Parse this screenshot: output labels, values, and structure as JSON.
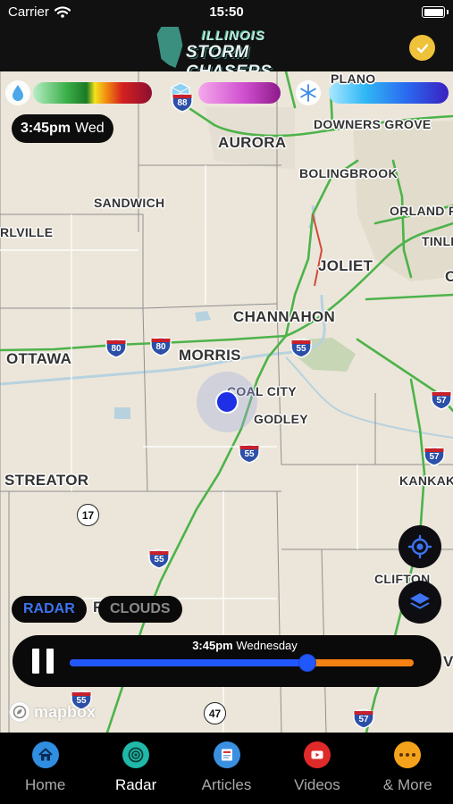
{
  "status_bar": {
    "carrier": "Carrier",
    "time": "15:50"
  },
  "header": {
    "logo_line1": "ILLINOIS",
    "logo_line2": "STORM CHASERS"
  },
  "legend": [
    {
      "icon": "raindrop-icon",
      "label": "rain",
      "color": "#4aa8e8"
    },
    {
      "icon": "ice-cube-icon",
      "label": "mix",
      "color": "#d050d0"
    },
    {
      "icon": "snowflake-icon",
      "label": "snow",
      "color": "#3a6af0"
    }
  ],
  "time_chip": {
    "time": "3:45pm",
    "day": "Wed"
  },
  "map": {
    "cities": [
      "AURORA",
      "DOWNERS GROVE",
      "BOLINGBROOK",
      "SANDWICH",
      "ORLAND PA",
      "TINLE",
      "RLVILLE",
      "JOLIET",
      "CHANNAHON",
      "OTTAWA",
      "MORRIS",
      "COAL CITY",
      "GODLEY",
      "STREATOR",
      "KANKAK",
      "CLIFTON",
      "PLANO",
      "O",
      "V",
      "F"
    ],
    "interstate_shields": [
      "80",
      "80",
      "55",
      "55",
      "55",
      "57",
      "57",
      "57",
      "55",
      "88"
    ],
    "routes": [
      "17",
      "47"
    ],
    "attribution": "mapbox"
  },
  "layer_toggle": {
    "radar": "RADAR",
    "clouds": "CLOUDS",
    "active": "radar"
  },
  "player": {
    "time": "3:45pm",
    "day": "Wednesday",
    "progress": 0.69,
    "state": "playing"
  },
  "colors": {
    "accent": "#2157ff",
    "track_remaining": "#f58212",
    "location_dot": "#1e2fe6"
  },
  "tabs": [
    {
      "label": "Home",
      "icon": "home-icon",
      "color": "#2f8ee0"
    },
    {
      "label": "Radar",
      "icon": "radar-icon",
      "color": "#20b8a8",
      "active": true
    },
    {
      "label": "Articles",
      "icon": "articles-icon",
      "color": "#3b8fe0"
    },
    {
      "label": "Videos",
      "icon": "video-icon",
      "color": "#e02a2a"
    },
    {
      "label": "& More",
      "icon": "more-icon",
      "color": "#f4a21b"
    }
  ]
}
